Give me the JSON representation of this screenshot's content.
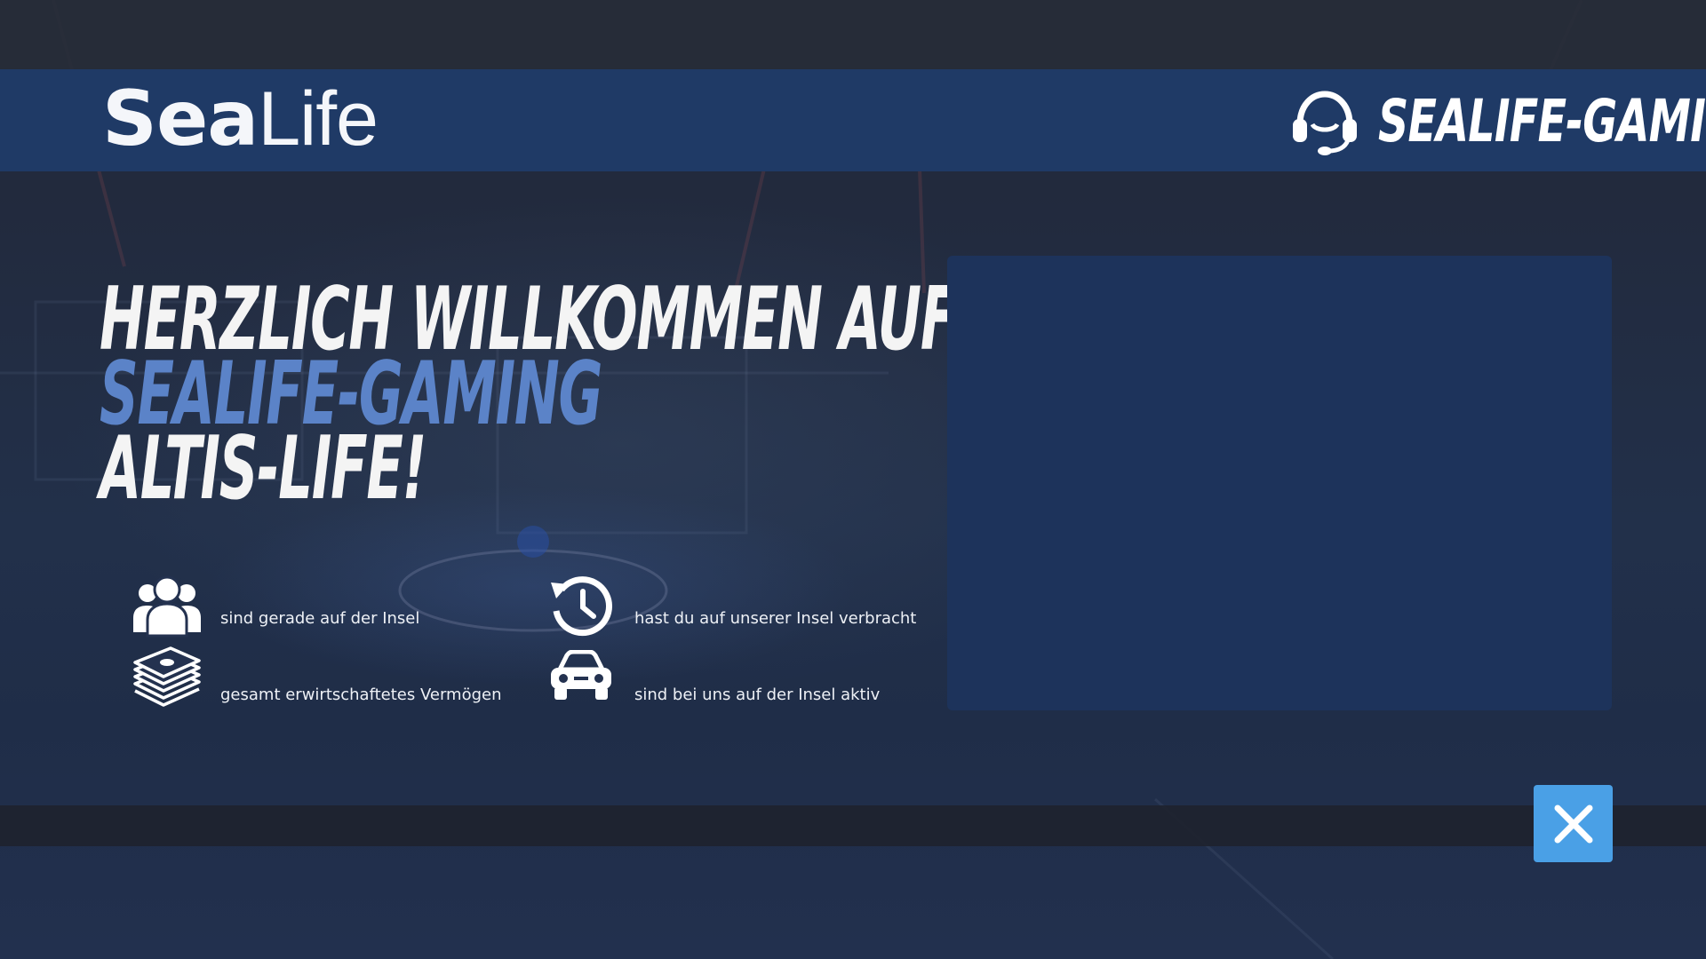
{
  "header": {
    "logo_bold": "Sea",
    "logo_light": "Life",
    "brand_name": "SEALIFE-GAMING",
    "brand_icon": "headset-icon"
  },
  "welcome": {
    "line1": "HERZLICH WILLKOMMEN AUF",
    "line2": "SEALIFE-GAMING",
    "line3": "ALTIS-LIFE!"
  },
  "stats": {
    "players": {
      "icon": "users-icon",
      "label": "sind gerade auf der Insel"
    },
    "time": {
      "icon": "history-icon",
      "label": "hast du auf unserer Insel verbracht"
    },
    "money": {
      "icon": "money-stack-icon",
      "label": "gesamt erwirtschaftetes Vermögen"
    },
    "cars": {
      "icon": "car-icon",
      "label": "sind bei uns auf der Insel aktiv"
    }
  },
  "close_button": {
    "icon": "close-icon"
  },
  "colors": {
    "header_bar": "#1f3a66",
    "panel": "#1d335b",
    "accent_blue": "#5b83c8",
    "close_button": "#4aa0e6"
  }
}
